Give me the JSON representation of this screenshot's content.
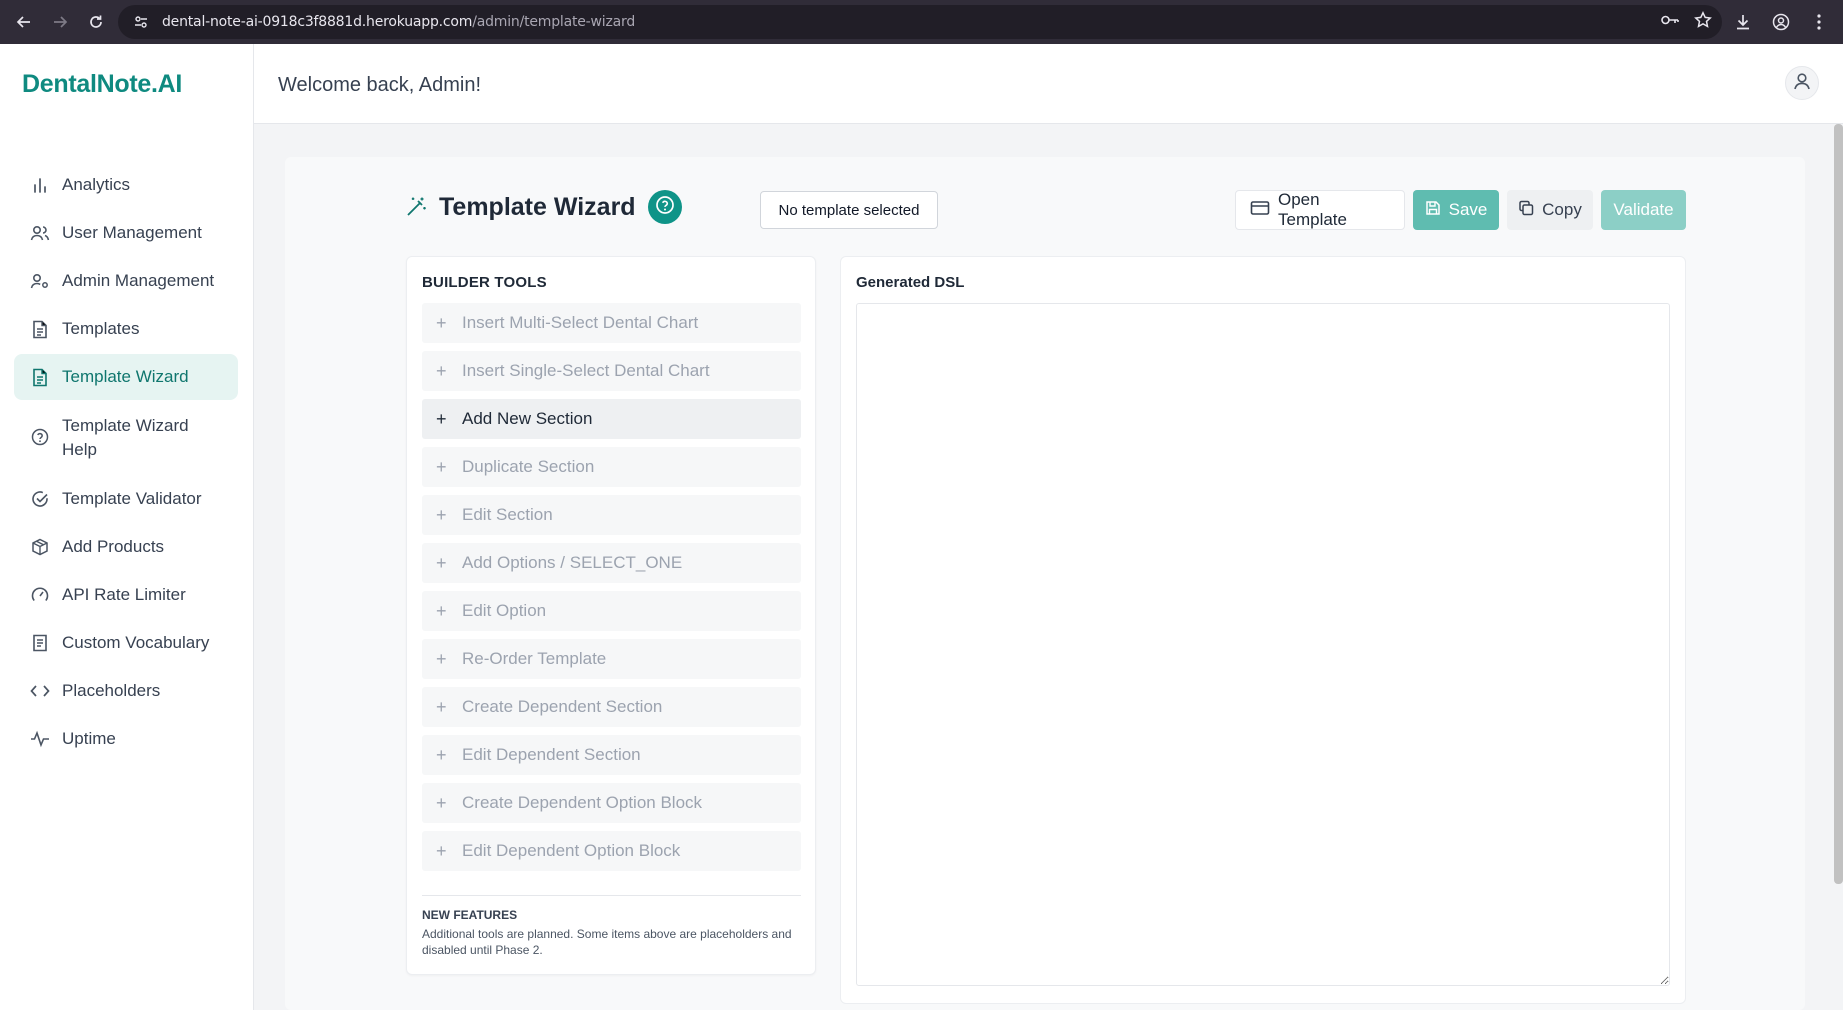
{
  "browser": {
    "url_host": "dental-note-ai-0918c3f8881d.herokuapp.com",
    "url_path": "/admin/template-wizard"
  },
  "sidebar": {
    "brand": "DentalNote.AI",
    "items": [
      {
        "label": "Analytics",
        "icon": "bar-chart-icon"
      },
      {
        "label": "User Management",
        "icon": "users-icon"
      },
      {
        "label": "Admin Management",
        "icon": "user-cog-icon"
      },
      {
        "label": "Templates",
        "icon": "file-text-icon"
      },
      {
        "label": "Template Wizard",
        "icon": "file-text-icon",
        "active": true
      },
      {
        "label": "Template Wizard Help",
        "icon": "help-circle-icon"
      },
      {
        "label": "Template Validator",
        "icon": "check-circle-icon"
      },
      {
        "label": "Add Products",
        "icon": "package-icon"
      },
      {
        "label": "API Rate Limiter",
        "icon": "gauge-icon"
      },
      {
        "label": "Custom Vocabulary",
        "icon": "book-icon"
      },
      {
        "label": "Placeholders",
        "icon": "code-icon"
      },
      {
        "label": "Uptime",
        "icon": "activity-icon"
      }
    ]
  },
  "header": {
    "welcome": "Welcome back, Admin!"
  },
  "wizard": {
    "title": "Template Wizard",
    "template_status": "No template selected",
    "actions": {
      "open": "Open Template",
      "save": "Save",
      "copy": "Copy",
      "validate": "Validate"
    }
  },
  "builder": {
    "title": "BUILDER TOOLS",
    "tools": [
      {
        "label": "Insert Multi-Select Dental Chart",
        "enabled": false
      },
      {
        "label": "Insert Single-Select Dental Chart",
        "enabled": false
      },
      {
        "label": "Add New Section",
        "enabled": true
      },
      {
        "label": "Duplicate Section",
        "enabled": false
      },
      {
        "label": "Edit Section",
        "enabled": false
      },
      {
        "label": "Add Options / SELECT_ONE",
        "enabled": false
      },
      {
        "label": "Edit Option",
        "enabled": false
      },
      {
        "label": "Re-Order Template",
        "enabled": false
      },
      {
        "label": "Create Dependent Section",
        "enabled": false
      },
      {
        "label": "Edit Dependent Section",
        "enabled": false
      },
      {
        "label": "Create Dependent Option Block",
        "enabled": false
      },
      {
        "label": "Edit Dependent Option Block",
        "enabled": false
      }
    ],
    "new_features_title": "NEW FEATURES",
    "new_features_text": "Additional tools are planned. Some items above are placeholders and disabled until Phase 2."
  },
  "dsl": {
    "title": "Generated DSL",
    "value": ""
  },
  "colors": {
    "brand": "#0f8a80",
    "accent": "#0f9488",
    "active_bg": "#e6f4f2"
  }
}
